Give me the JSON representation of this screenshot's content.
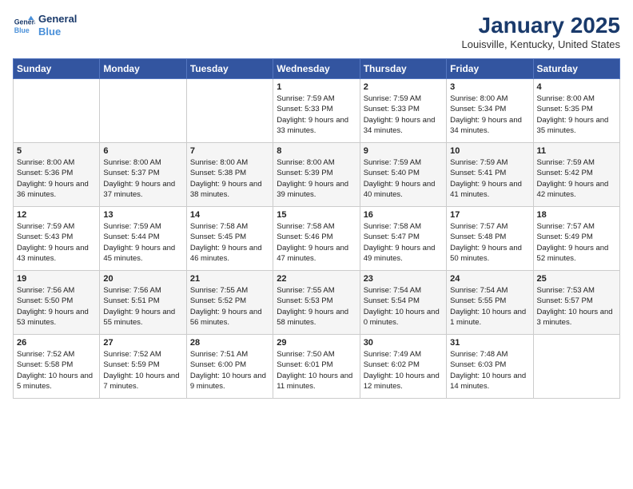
{
  "header": {
    "logo_line1": "General",
    "logo_line2": "Blue",
    "month": "January 2025",
    "location": "Louisville, Kentucky, United States"
  },
  "days_of_week": [
    "Sunday",
    "Monday",
    "Tuesday",
    "Wednesday",
    "Thursday",
    "Friday",
    "Saturday"
  ],
  "weeks": [
    [
      {
        "day": "",
        "info": ""
      },
      {
        "day": "",
        "info": ""
      },
      {
        "day": "",
        "info": ""
      },
      {
        "day": "1",
        "info": "Sunrise: 7:59 AM\nSunset: 5:33 PM\nDaylight: 9 hours and 33 minutes."
      },
      {
        "day": "2",
        "info": "Sunrise: 7:59 AM\nSunset: 5:33 PM\nDaylight: 9 hours and 34 minutes."
      },
      {
        "day": "3",
        "info": "Sunrise: 8:00 AM\nSunset: 5:34 PM\nDaylight: 9 hours and 34 minutes."
      },
      {
        "day": "4",
        "info": "Sunrise: 8:00 AM\nSunset: 5:35 PM\nDaylight: 9 hours and 35 minutes."
      }
    ],
    [
      {
        "day": "5",
        "info": "Sunrise: 8:00 AM\nSunset: 5:36 PM\nDaylight: 9 hours and 36 minutes."
      },
      {
        "day": "6",
        "info": "Sunrise: 8:00 AM\nSunset: 5:37 PM\nDaylight: 9 hours and 37 minutes."
      },
      {
        "day": "7",
        "info": "Sunrise: 8:00 AM\nSunset: 5:38 PM\nDaylight: 9 hours and 38 minutes."
      },
      {
        "day": "8",
        "info": "Sunrise: 8:00 AM\nSunset: 5:39 PM\nDaylight: 9 hours and 39 minutes."
      },
      {
        "day": "9",
        "info": "Sunrise: 7:59 AM\nSunset: 5:40 PM\nDaylight: 9 hours and 40 minutes."
      },
      {
        "day": "10",
        "info": "Sunrise: 7:59 AM\nSunset: 5:41 PM\nDaylight: 9 hours and 41 minutes."
      },
      {
        "day": "11",
        "info": "Sunrise: 7:59 AM\nSunset: 5:42 PM\nDaylight: 9 hours and 42 minutes."
      }
    ],
    [
      {
        "day": "12",
        "info": "Sunrise: 7:59 AM\nSunset: 5:43 PM\nDaylight: 9 hours and 43 minutes."
      },
      {
        "day": "13",
        "info": "Sunrise: 7:59 AM\nSunset: 5:44 PM\nDaylight: 9 hours and 45 minutes."
      },
      {
        "day": "14",
        "info": "Sunrise: 7:58 AM\nSunset: 5:45 PM\nDaylight: 9 hours and 46 minutes."
      },
      {
        "day": "15",
        "info": "Sunrise: 7:58 AM\nSunset: 5:46 PM\nDaylight: 9 hours and 47 minutes."
      },
      {
        "day": "16",
        "info": "Sunrise: 7:58 AM\nSunset: 5:47 PM\nDaylight: 9 hours and 49 minutes."
      },
      {
        "day": "17",
        "info": "Sunrise: 7:57 AM\nSunset: 5:48 PM\nDaylight: 9 hours and 50 minutes."
      },
      {
        "day": "18",
        "info": "Sunrise: 7:57 AM\nSunset: 5:49 PM\nDaylight: 9 hours and 52 minutes."
      }
    ],
    [
      {
        "day": "19",
        "info": "Sunrise: 7:56 AM\nSunset: 5:50 PM\nDaylight: 9 hours and 53 minutes."
      },
      {
        "day": "20",
        "info": "Sunrise: 7:56 AM\nSunset: 5:51 PM\nDaylight: 9 hours and 55 minutes."
      },
      {
        "day": "21",
        "info": "Sunrise: 7:55 AM\nSunset: 5:52 PM\nDaylight: 9 hours and 56 minutes."
      },
      {
        "day": "22",
        "info": "Sunrise: 7:55 AM\nSunset: 5:53 PM\nDaylight: 9 hours and 58 minutes."
      },
      {
        "day": "23",
        "info": "Sunrise: 7:54 AM\nSunset: 5:54 PM\nDaylight: 10 hours and 0 minutes."
      },
      {
        "day": "24",
        "info": "Sunrise: 7:54 AM\nSunset: 5:55 PM\nDaylight: 10 hours and 1 minute."
      },
      {
        "day": "25",
        "info": "Sunrise: 7:53 AM\nSunset: 5:57 PM\nDaylight: 10 hours and 3 minutes."
      }
    ],
    [
      {
        "day": "26",
        "info": "Sunrise: 7:52 AM\nSunset: 5:58 PM\nDaylight: 10 hours and 5 minutes."
      },
      {
        "day": "27",
        "info": "Sunrise: 7:52 AM\nSunset: 5:59 PM\nDaylight: 10 hours and 7 minutes."
      },
      {
        "day": "28",
        "info": "Sunrise: 7:51 AM\nSunset: 6:00 PM\nDaylight: 10 hours and 9 minutes."
      },
      {
        "day": "29",
        "info": "Sunrise: 7:50 AM\nSunset: 6:01 PM\nDaylight: 10 hours and 11 minutes."
      },
      {
        "day": "30",
        "info": "Sunrise: 7:49 AM\nSunset: 6:02 PM\nDaylight: 10 hours and 12 minutes."
      },
      {
        "day": "31",
        "info": "Sunrise: 7:48 AM\nSunset: 6:03 PM\nDaylight: 10 hours and 14 minutes."
      },
      {
        "day": "",
        "info": ""
      }
    ]
  ]
}
